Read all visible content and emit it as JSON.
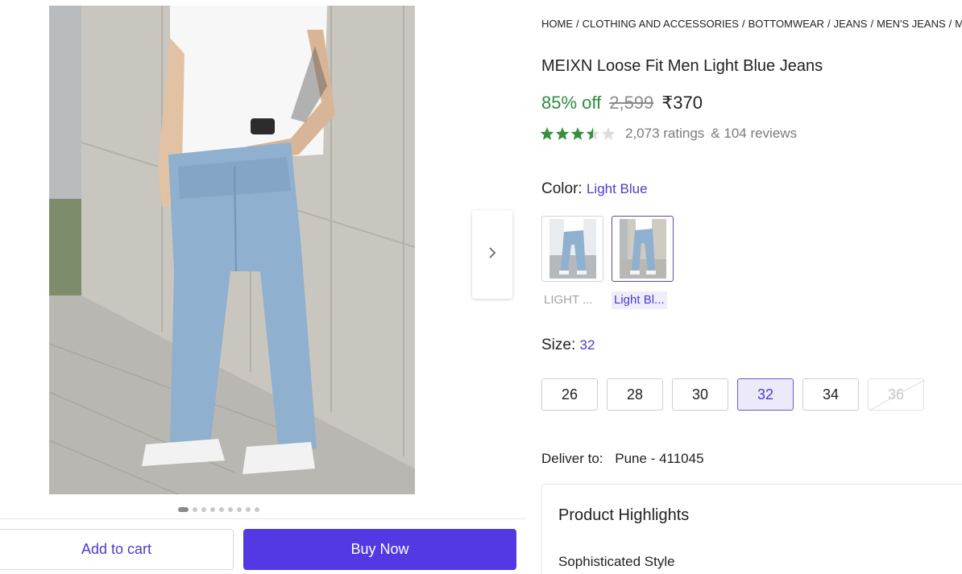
{
  "breadcrumb": [
    "HOME",
    "CLOTHING AND ACCESSORIES",
    "BOTTOMWEAR",
    "JEANS",
    "MEN'S JEANS",
    "MEIXN"
  ],
  "product": {
    "title": "MEIXN Loose Fit Men Light Blue Jeans",
    "discount": "85% off",
    "mrp": "2,599",
    "price": "₹370",
    "rating_value": 3.5,
    "ratings": "2,073 ratings",
    "reviews": "& 104 reviews"
  },
  "color": {
    "label": "Color:",
    "selected": "Light Blue",
    "options": [
      {
        "label": "LIGHT ...",
        "selected": false
      },
      {
        "label": "Light Bl...",
        "selected": true
      }
    ]
  },
  "size": {
    "label": "Size:",
    "selected": "32",
    "options": [
      {
        "label": "26",
        "state": "available"
      },
      {
        "label": "28",
        "state": "available"
      },
      {
        "label": "30",
        "state": "available"
      },
      {
        "label": "32",
        "state": "selected"
      },
      {
        "label": "34",
        "state": "available"
      },
      {
        "label": "36",
        "state": "unavailable"
      }
    ]
  },
  "delivery": {
    "label": "Deliver to:",
    "location": "Pune - 411045"
  },
  "highlights": {
    "title": "Product Highlights",
    "items": [
      "Sophisticated Style"
    ]
  },
  "gallery": {
    "image_count": 9,
    "active_index": 0,
    "next_icon": "chevron-right-icon"
  },
  "actions": {
    "add_to_cart": "Add to cart",
    "buy_now": "Buy Now"
  },
  "colors": {
    "accent": "#4b3bd1",
    "buy_button": "#5239e3",
    "discount_green": "#2e8b3d",
    "star_green": "#388e3c"
  }
}
